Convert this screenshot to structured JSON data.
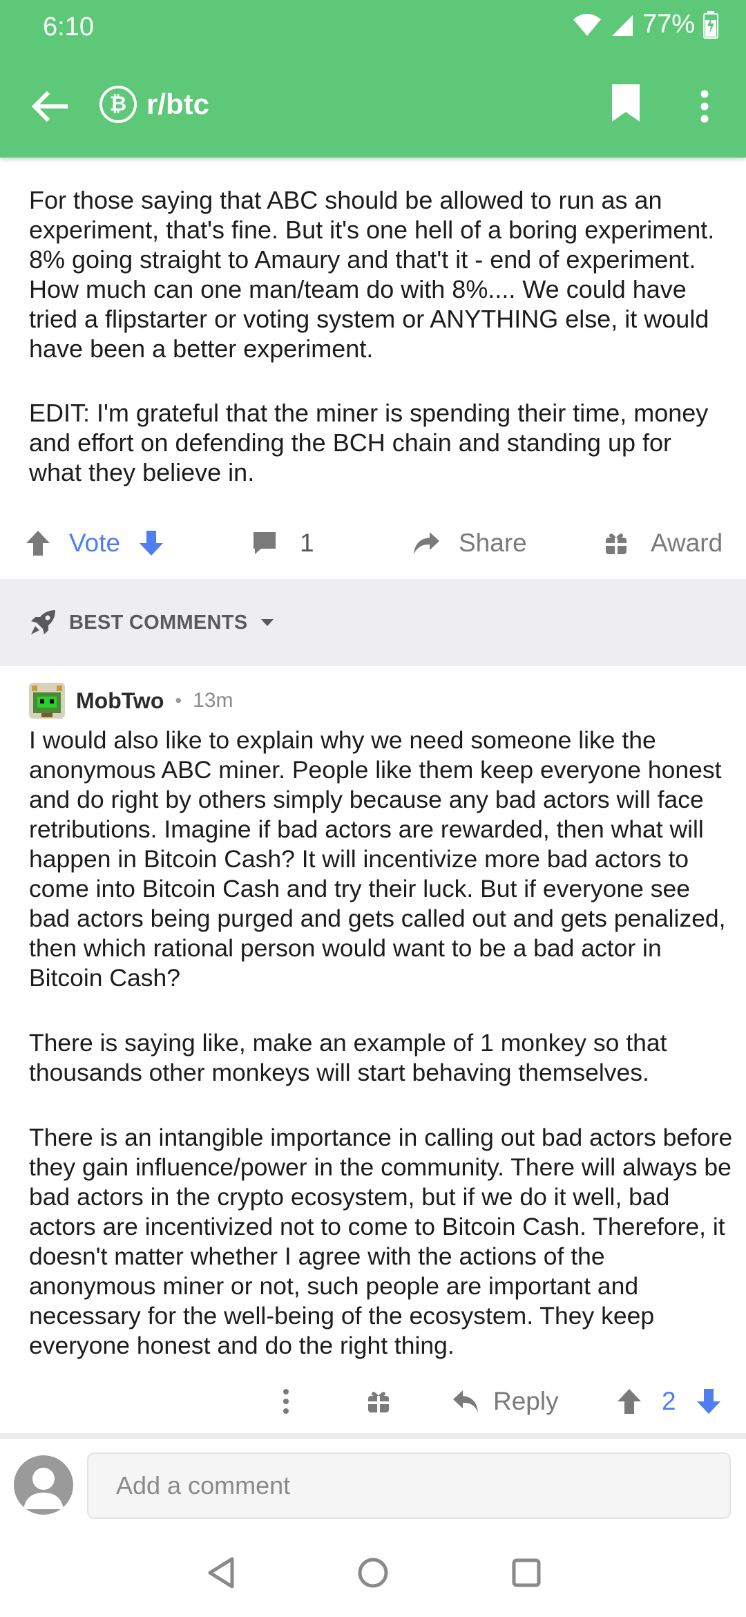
{
  "status_bar": {
    "time": "6:10",
    "battery": "77%"
  },
  "app_bar": {
    "subreddit": "r/btc"
  },
  "post": {
    "paragraphs": [
      "For those saying that ABC should be allowed to run as an experiment, that's fine. But it's one hell of a boring experiment. 8% going straight to Amaury and that't it - end of experiment. How much can one man/team do with 8%.... We could have tried a flipstarter or voting system or ANYTHING else, it would have been a better experiment.",
      "EDIT: I'm grateful that the miner is spending their time, money and effort on defending the BCH chain and standing up for what they believe in."
    ],
    "actions": {
      "vote": "Vote",
      "comments": "1",
      "share": "Share",
      "award": "Award"
    }
  },
  "sort": {
    "label": "BEST COMMENTS"
  },
  "comment": {
    "user": "MobTwo",
    "time": "13m",
    "paragraphs": [
      "I would also like to explain why we need someone like the anonymous ABC miner. People like them keep everyone honest and do right by others simply because any bad actors will face retributions. Imagine if bad actors are rewarded, then what will happen in Bitcoin Cash? It will incentivize more bad actors to come into Bitcoin Cash and try their luck. But if everyone see bad actors being purged and gets called out and gets penalized, then which rational person would want to be a bad actor in Bitcoin Cash?",
      "There is saying like, make an example of 1 monkey so that thousands other monkeys will start behaving themselves.",
      "There is an intangible importance in calling out bad actors before they gain influence/power in the community. There will always be bad actors in the crypto ecosystem, but if we do it well, bad actors are incentivized not to come to Bitcoin Cash. Therefore, it doesn't matter whether I agree with the actions of the anonymous miner or not, such people are important and necessary for the well-being of the ecosystem. They keep everyone honest and do the right thing."
    ],
    "reply_label": "Reply",
    "score": "2"
  },
  "composer": {
    "placeholder": "Add a comment"
  },
  "colors": {
    "app_bar": "#5dc878",
    "vote_blue": "#4e7ef0",
    "section_bg": "#eeeef0"
  }
}
